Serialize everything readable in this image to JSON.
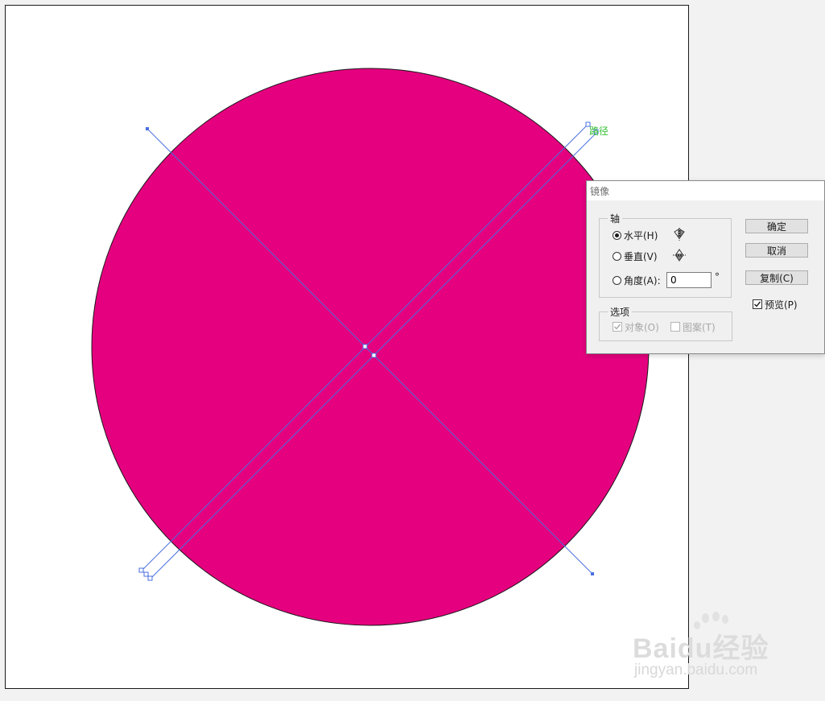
{
  "canvas": {
    "fill_color": "#e5007f",
    "stroke_color": "#1a1a1a",
    "path_color": "#4a6fe0",
    "path_label_color": "#35c035",
    "path_label": "路径"
  },
  "dialog": {
    "title": "镜像",
    "axis_group": {
      "legend": "轴",
      "horizontal": "水平(H)",
      "vertical": "垂直(V)",
      "angle": "角度(A):",
      "angle_value": "0",
      "degree": "°",
      "selected": "horizontal"
    },
    "options_group": {
      "legend": "选项",
      "objects": "对象(O)",
      "patterns": "图案(T)"
    },
    "buttons": {
      "ok": "确定",
      "cancel": "取消",
      "copy": "复制(C)"
    },
    "preview": {
      "label": "预览(P)",
      "checked": true
    }
  },
  "watermark": {
    "brand": "Baidu经验",
    "url": "jingyan.baidu.com"
  }
}
